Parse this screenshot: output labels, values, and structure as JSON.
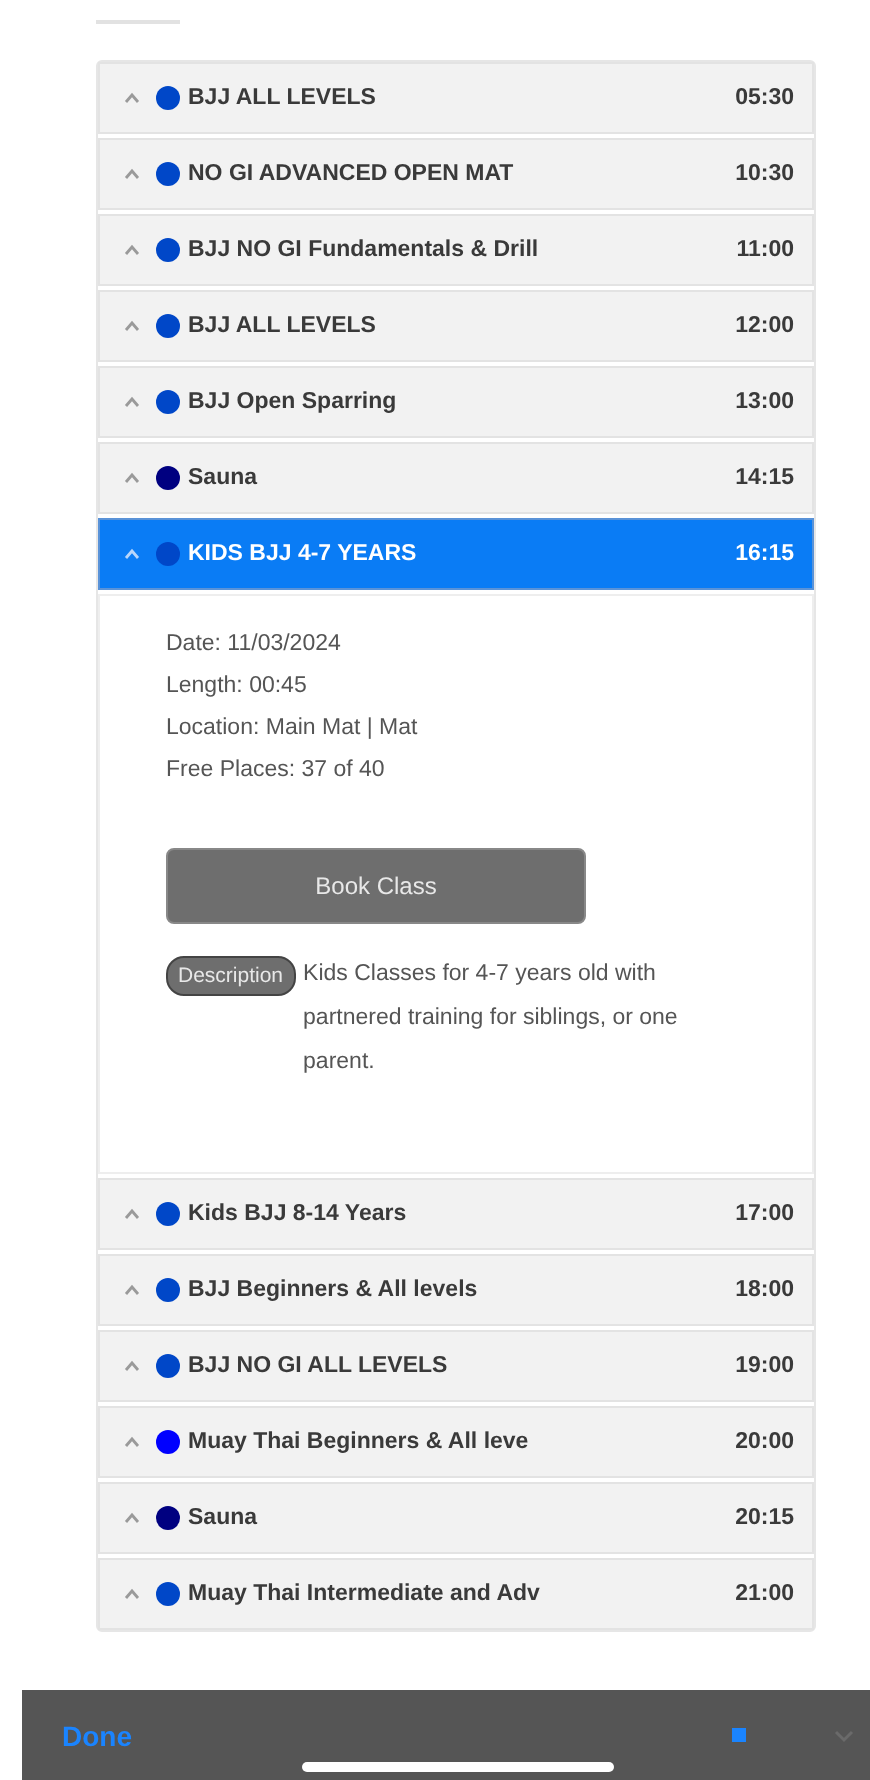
{
  "classes": [
    {
      "name": "BJJ ALL LEVELS",
      "time": "05:30",
      "color": "#0047c8",
      "selected": false
    },
    {
      "name": "NO GI ADVANCED OPEN MAT",
      "time": "10:30",
      "color": "#0047c8",
      "selected": false
    },
    {
      "name": "BJJ NO GI Fundamentals & Drill",
      "time": "11:00",
      "color": "#0047c8",
      "selected": false
    },
    {
      "name": "BJJ ALL LEVELS",
      "time": "12:00",
      "color": "#0047c8",
      "selected": false
    },
    {
      "name": "BJJ Open Sparring",
      "time": "13:00",
      "color": "#0047c8",
      "selected": false
    },
    {
      "name": "Sauna",
      "time": "14:15",
      "color": "#000080",
      "selected": false
    },
    {
      "name": "KIDS BJJ 4-7 YEARS",
      "time": "16:15",
      "color": "#0047c8",
      "selected": true,
      "details": {
        "lines": [
          "Date: 11/03/2024",
          "Length: 00:45",
          "Location: Main Mat | Mat",
          "Free Places: 37 of 40"
        ],
        "button": "Book Class",
        "description_label": "Description",
        "description": "Kids Classes for 4-7 years old with partnered training for siblings, or one parent."
      }
    },
    {
      "name": "Kids BJJ 8-14 Years",
      "time": "17:00",
      "color": "#0047c8",
      "selected": false
    },
    {
      "name": "BJJ Beginners & All levels",
      "time": "18:00",
      "color": "#0047c8",
      "selected": false
    },
    {
      "name": "BJJ NO GI ALL LEVELS",
      "time": "19:00",
      "color": "#0047c8",
      "selected": false
    },
    {
      "name": "Muay Thai Beginners & All leve",
      "time": "20:00",
      "color": "#0000ff",
      "selected": false
    },
    {
      "name": "Sauna",
      "time": "20:15",
      "color": "#000080",
      "selected": false
    },
    {
      "name": "Muay Thai Intermediate and Adv",
      "time": "21:00",
      "color": "#0047c8",
      "selected": false
    }
  ],
  "toolbar": {
    "done": "Done"
  }
}
